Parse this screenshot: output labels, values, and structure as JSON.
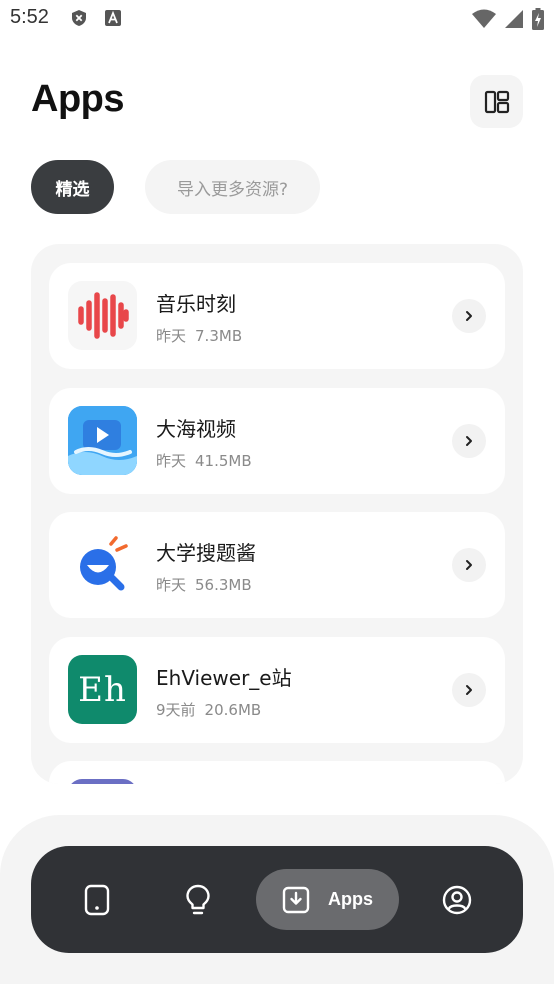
{
  "status_bar": {
    "time": "5:52",
    "left_icons": [
      "shield-x-icon",
      "font-a-icon"
    ],
    "right_icons": [
      "wifi-icon",
      "signal-icon",
      "battery-charging-icon"
    ]
  },
  "header": {
    "title": "Apps",
    "layout_toggle_icon": "dashboard-layout-icon"
  },
  "tabs": [
    {
      "label": "精选",
      "active": true
    },
    {
      "label": "导入更多资源?",
      "active": false
    }
  ],
  "apps": [
    {
      "name": "音乐时刻",
      "date": "昨天",
      "size": "7.3MB",
      "icon": "sound-wave-icon"
    },
    {
      "name": "大海视频",
      "date": "昨天",
      "size": "41.5MB",
      "icon": "video-play-icon"
    },
    {
      "name": "大学搜题酱",
      "date": "昨天",
      "size": "56.3MB",
      "icon": "search-smile-icon"
    },
    {
      "name": "EhViewer_e站",
      "date": "9天前",
      "size": "20.6MB",
      "icon": "eh-logo-icon",
      "icon_text": "Eh"
    }
  ],
  "bottom_nav": {
    "items": [
      {
        "id": "device",
        "icon": "phone-icon"
      },
      {
        "id": "ideas",
        "icon": "lightbulb-icon"
      },
      {
        "id": "apps",
        "icon": "download-box-icon",
        "label": "Apps",
        "active": true
      },
      {
        "id": "profile",
        "icon": "user-circle-icon"
      }
    ]
  },
  "colors": {
    "accent_dark": "#3a3d40",
    "nav_bg": "#303236",
    "music_red": "#e8474a",
    "ocean_blue": "#3fa6f2",
    "search_blue": "#2a6fe8",
    "eh_green": "#0f8a6c"
  }
}
